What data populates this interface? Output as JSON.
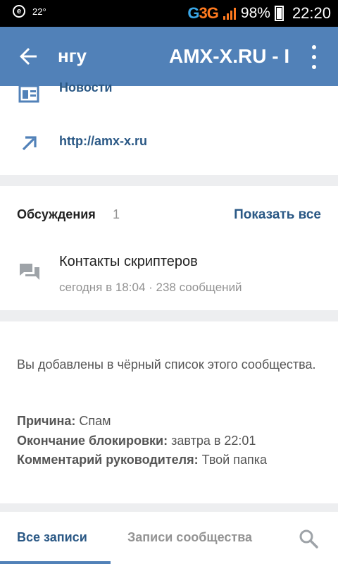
{
  "statusbar": {
    "left_icon": "e",
    "temperature": "22°",
    "network_g": "G",
    "network_3g": "3G",
    "battery": "98%",
    "time": "22:20"
  },
  "appbar": {
    "back_icon": "arrow-left-icon",
    "title_left": "нгу",
    "title": "AMX-X.RU - I",
    "menu_icon": "more-vertical-icon"
  },
  "links": {
    "news_label": "Новости",
    "website_label": "http://amx-x.ru"
  },
  "discussions": {
    "title": "Обсуждения",
    "count": "1",
    "show_all": "Показать все",
    "item_title": "Контакты скриптеров",
    "item_meta": "сегодня в 18:04 · 238 сообщений"
  },
  "ban": {
    "message": "Вы добавлены в чёрный список этого сообщества.",
    "reason_label": "Причина:",
    "reason_value": "Спам",
    "until_label": "Окончание блокировки:",
    "until_value": "завтра в 22:01",
    "comment_label": "Комментарий руководителя:",
    "comment_value": "Твой папка"
  },
  "tabs": {
    "all": "Все записи",
    "community": "Записи сообщества"
  },
  "colors": {
    "appbar": "#5181b8",
    "link": "#2a5885",
    "muted": "#939393"
  }
}
